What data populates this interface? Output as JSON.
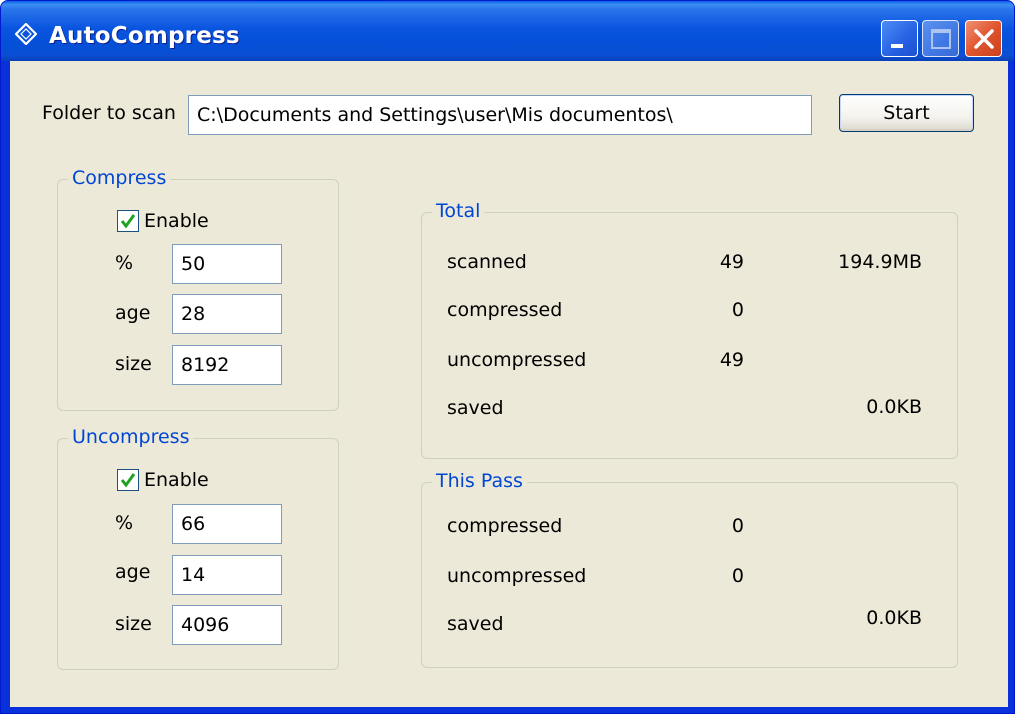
{
  "window": {
    "title": "AutoCompress"
  },
  "scan": {
    "label": "Folder to scan",
    "folder": "C:\\Documents and Settings\\user\\Mis documentos\\",
    "start_label": "Start"
  },
  "compress": {
    "title": "Compress",
    "enable_label": "Enable",
    "enabled": true,
    "percent_label": "%",
    "percent": "50",
    "age_label": "age",
    "age": "28",
    "size_label": "size",
    "size": "8192"
  },
  "uncompress": {
    "title": "Uncompress",
    "enable_label": "Enable",
    "enabled": true,
    "percent_label": "%",
    "percent": "66",
    "age_label": "age",
    "age": "14",
    "size_label": "size",
    "size": "4096"
  },
  "total": {
    "title": "Total",
    "rows": [
      {
        "label": "scanned",
        "count": "49",
        "size": "194.9MB"
      },
      {
        "label": "compressed",
        "count": "0",
        "size": ""
      },
      {
        "label": "uncompressed",
        "count": "49",
        "size": ""
      },
      {
        "label": "saved",
        "count": "",
        "size": "0.0KB"
      }
    ]
  },
  "this_pass": {
    "title": "This Pass",
    "rows": [
      {
        "label": "compressed",
        "count": "0",
        "size": ""
      },
      {
        "label": "uncompressed",
        "count": "0",
        "size": ""
      },
      {
        "label": "saved",
        "count": "",
        "size": "0.0KB"
      }
    ]
  },
  "colors": {
    "titlebar": "#0a55df",
    "client": "#ece9d8",
    "group_title": "#0046d5",
    "check": "#21a121"
  },
  "icons": {
    "app": "diamond-icon",
    "minimize": "minimize-icon",
    "maximize": "maximize-icon",
    "close": "close-icon",
    "check": "check-icon"
  }
}
